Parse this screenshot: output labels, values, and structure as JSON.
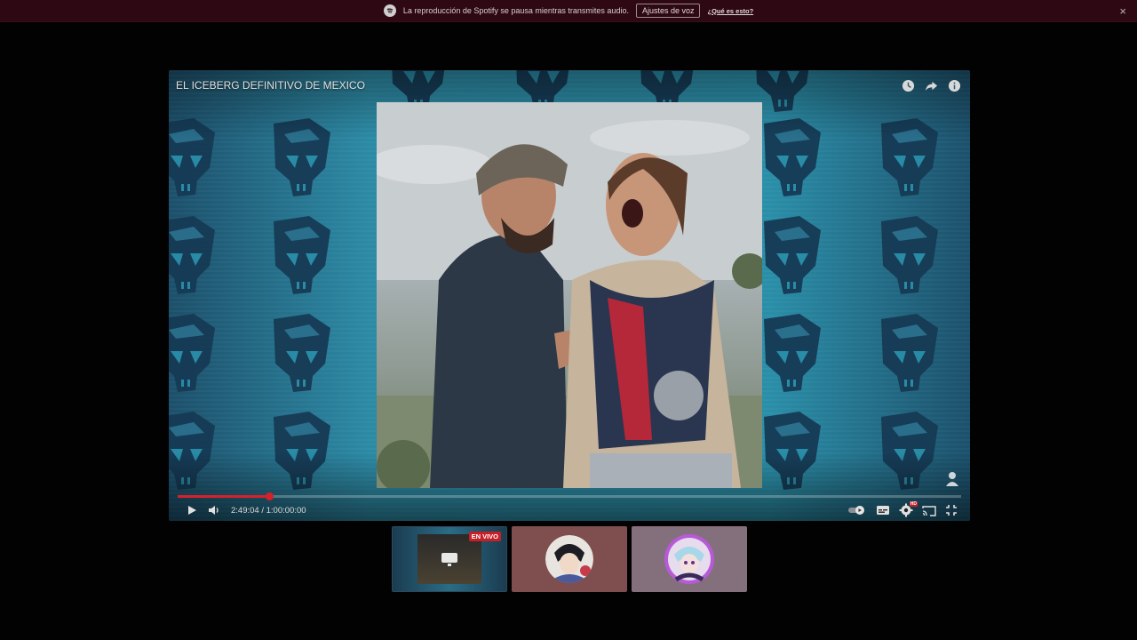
{
  "banner": {
    "message": "La reproducción de Spotify se pausa mientras transmites audio.",
    "voice_settings_label": "Ajustes de voz",
    "what_link": "¿Qué es esto?",
    "close_label": "×",
    "spotify_color": "#cfcfcf"
  },
  "player": {
    "title": "EL ICEBERG DEFINITIVO DE MEXICO",
    "time_current": "2:49:04",
    "time_separator": "/",
    "time_total": "1:00:00:00",
    "progress_fraction": 0.117,
    "accent_color": "#d8202a",
    "icons": {
      "top": [
        "clock-icon",
        "share-icon",
        "info-icon"
      ],
      "controls_left": [
        "play-icon",
        "volume-icon"
      ],
      "controls_right": [
        "autoplay-toggle",
        "subtitles-icon",
        "settings-icon",
        "cast-icon",
        "exit-fullscreen-icon"
      ]
    },
    "hd_badge": "HD"
  },
  "thumbnails": [
    {
      "id": "stream",
      "badge": "EN VIVO"
    },
    {
      "id": "user-1"
    },
    {
      "id": "user-2"
    }
  ]
}
